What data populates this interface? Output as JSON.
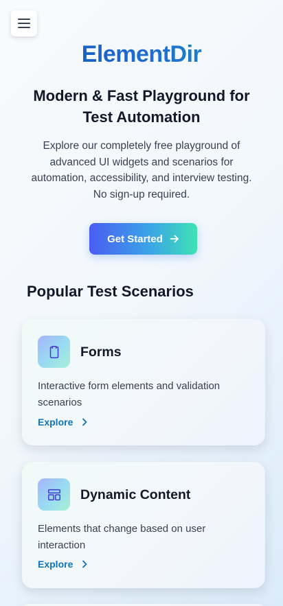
{
  "header": {
    "menu_icon": "hamburger-menu-icon",
    "brand": "ElementDir"
  },
  "hero": {
    "title": "Modern & Fast Playground for Test Automation",
    "description": "Explore our completely free playground of advanced UI widgets and scenarios for automation, accessibility, and interview testing. No sign-up required.",
    "cta_label": "Get Started",
    "cta_icon": "arrow-right-icon"
  },
  "section": {
    "title": "Popular Test Scenarios"
  },
  "cards": [
    {
      "icon": "clipboard-icon",
      "title": "Forms",
      "description": "Interactive form elements and validation scenarios",
      "link_label": "Explore",
      "link_icon": "chevron-right-icon"
    },
    {
      "icon": "layout-icon",
      "title": "Dynamic Content",
      "description": "Elements that change based on user interaction",
      "link_label": "Explore",
      "link_icon": "chevron-right-icon"
    }
  ],
  "colors": {
    "brand_start": "#0f52ba",
    "brand_end": "#1c9ab0",
    "cta_start": "#4a5df2",
    "cta_end": "#3ee2b5",
    "link": "#0e73b7",
    "icon_stroke": "#4338ca"
  }
}
